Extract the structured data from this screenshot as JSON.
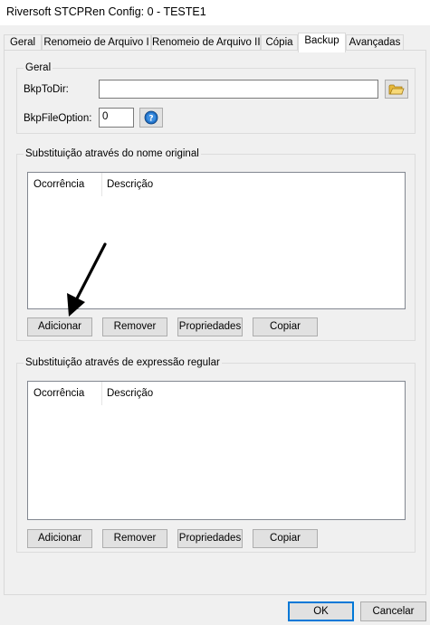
{
  "window": {
    "title": "Riversoft STCPRen Config: 0 - TESTE1"
  },
  "tabs": [
    {
      "label": "Geral"
    },
    {
      "label": "Renomeio de Arquivo I"
    },
    {
      "label": "Renomeio de Arquivo II"
    },
    {
      "label": "Cópia"
    },
    {
      "label": "Backup",
      "active": true
    },
    {
      "label": "Avançadas"
    }
  ],
  "geral": {
    "title": "Geral",
    "bkp_to_dir_label": "BkpToDir:",
    "bkp_to_dir_value": "",
    "bkp_file_option_label": "BkpFileOption:",
    "bkp_file_option_value": "0"
  },
  "nome_original": {
    "title": "Substituição através do nome original",
    "columns": [
      "Ocorrência",
      "Descrição"
    ],
    "rows": [],
    "buttons": {
      "add": "Adicionar",
      "remove": "Remover",
      "properties": "Propriedades",
      "copy": "Copiar"
    }
  },
  "expressao_regular": {
    "title": "Substituição através de expressão regular",
    "columns": [
      "Ocorrência",
      "Descrição"
    ],
    "rows": [],
    "buttons": {
      "add": "Adicionar",
      "remove": "Remover",
      "properties": "Propriedades",
      "copy": "Copiar"
    }
  },
  "footer": {
    "ok": "OK",
    "cancel": "Cancelar"
  },
  "colors": {
    "default_button_border": "#0078d7",
    "folder_icon": "#f2c94c",
    "info_icon": "#1f6fc5"
  }
}
